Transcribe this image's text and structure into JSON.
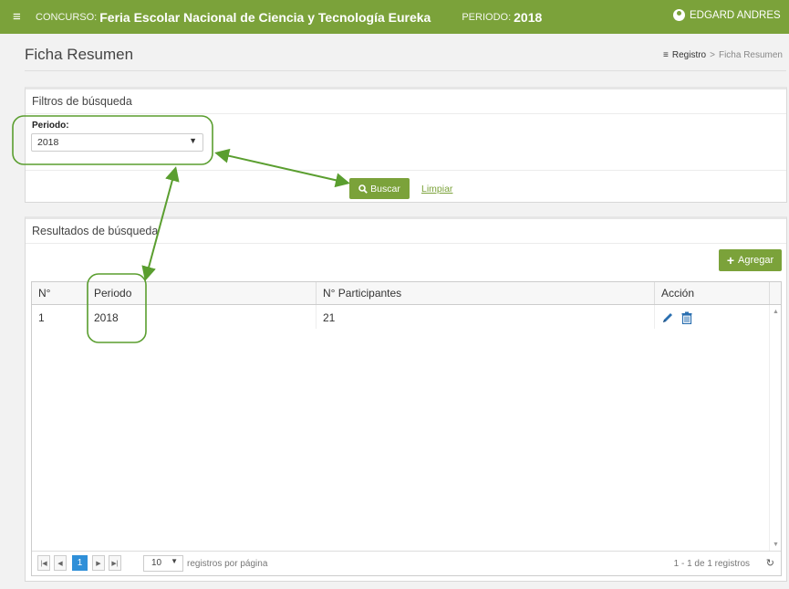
{
  "topbar": {
    "menu_icon": "hamburger-icon",
    "concurso_label": "CONCURSO:",
    "concurso_value": "Feria Escolar Nacional de Ciencia y Tecnología Eureka",
    "periodo_label": "PERIODO:",
    "periodo_value": "2018",
    "user_name": "EDGARD ANDRES",
    "user_icon": "user-circle-icon"
  },
  "page": {
    "title": "Ficha Resumen"
  },
  "breadcrumb": {
    "root": "Registro",
    "separator": ">",
    "current": "Ficha Resumen"
  },
  "filters": {
    "title": "Filtros de búsqueda",
    "periodo_label": "Periodo:",
    "periodo_selected": "2018",
    "search_button": "Buscar",
    "clear_link": "Limpiar"
  },
  "results": {
    "title": "Resultados de búsqueda",
    "add_button": "Agregar",
    "columns": [
      "N°",
      "Periodo",
      "N° Participantes",
      "Acción"
    ],
    "rows": [
      {
        "n": "1",
        "periodo": "2018",
        "participantes": "21"
      }
    ]
  },
  "pager": {
    "current_page": "1",
    "page_size": "10",
    "page_size_label": "registros por página",
    "info": "1 - 1 de 1 registros"
  },
  "colors": {
    "accent": "#7ba23a",
    "annotation": "#5a9e2f",
    "link_blue": "#2f8fd8"
  }
}
